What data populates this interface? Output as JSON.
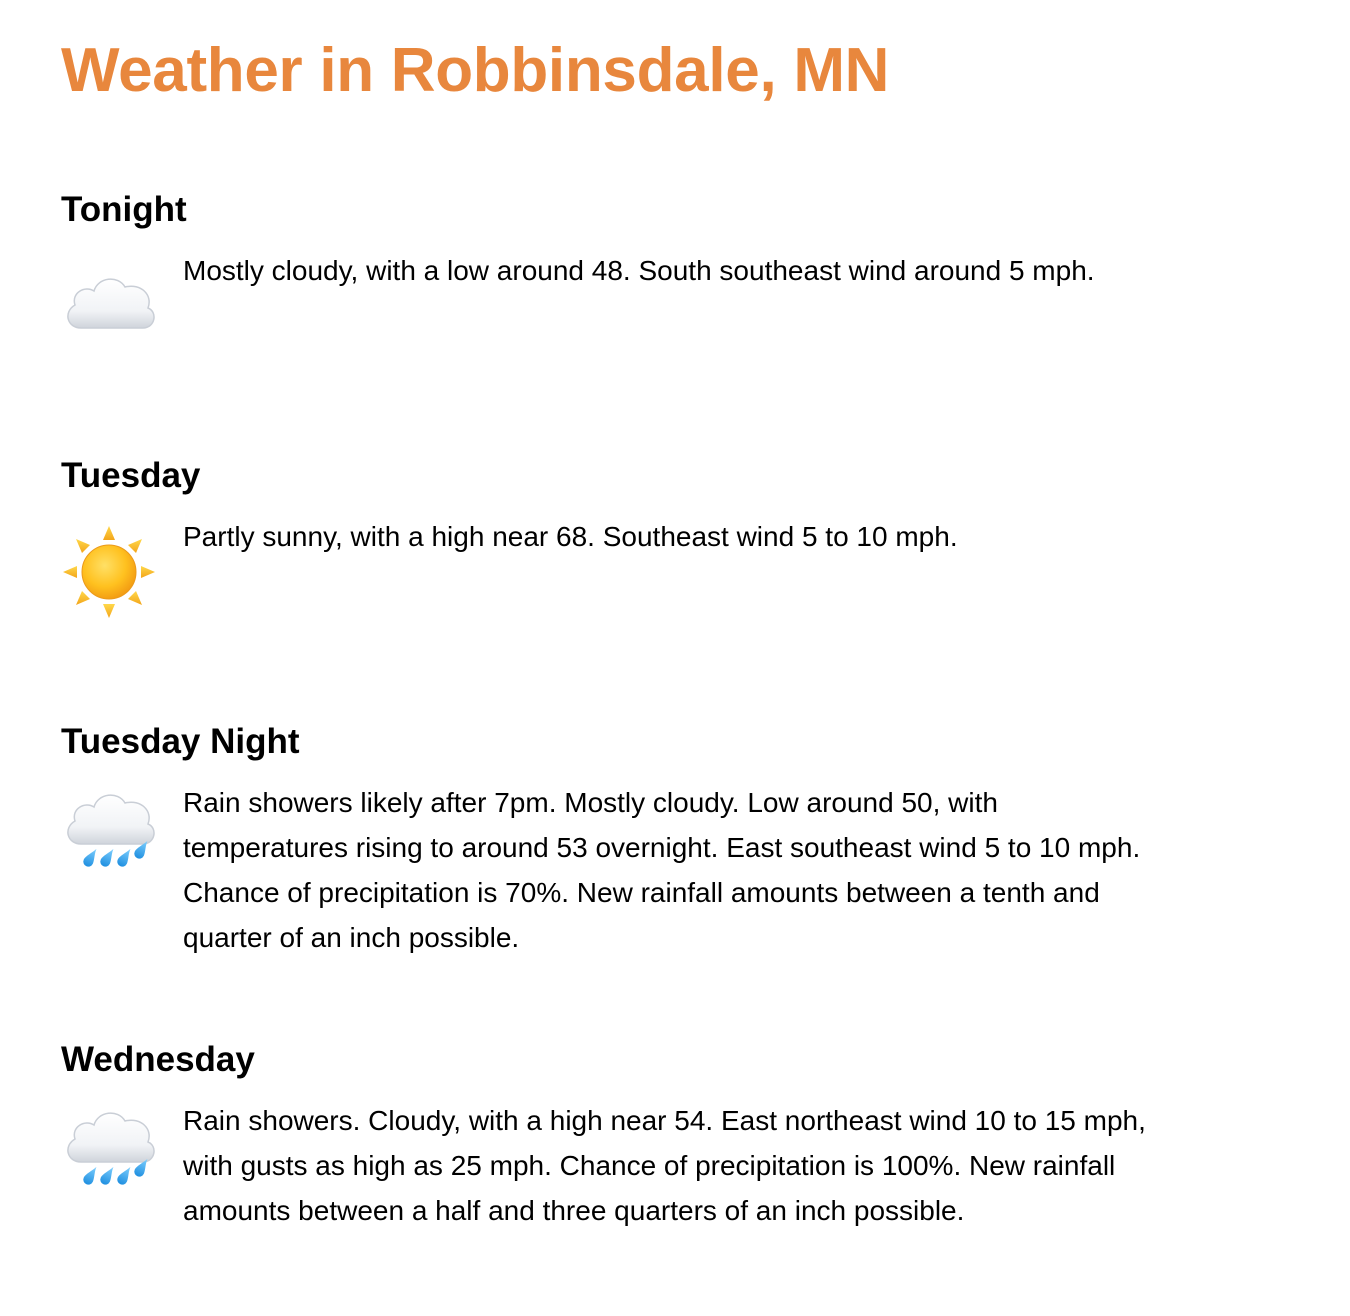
{
  "page": {
    "title": "Weather in Robbinsdale, MN",
    "title_color": "#e8873d"
  },
  "forecast": [
    {
      "name": "Tonight",
      "icon": "cloud-icon",
      "description": "Mostly cloudy, with a low around 48. South southeast wind around 5 mph."
    },
    {
      "name": "Tuesday",
      "icon": "sun-icon",
      "description": "Partly sunny, with a high near 68. Southeast wind 5 to 10 mph."
    },
    {
      "name": "Tuesday Night",
      "icon": "rain-cloud-icon",
      "description": "Rain showers likely after 7pm. Mostly cloudy. Low around 50, with temperatures rising to around 53 overnight. East southeast wind 5 to 10 mph. Chance of precipitation is 70%. New rainfall amounts between a tenth and quarter of an inch possible."
    },
    {
      "name": "Wednesday",
      "icon": "rain-cloud-icon",
      "description": "Rain showers. Cloudy, with a high near 54. East northeast wind 10 to 15 mph, with gusts as high as 25 mph. Chance of precipitation is 100%. New rainfall amounts between a half and three quarters of an inch possible."
    }
  ]
}
